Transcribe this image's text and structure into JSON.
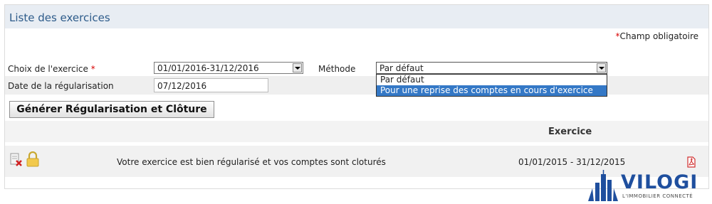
{
  "panel": {
    "title": "Liste des exercices"
  },
  "required_note": {
    "star": "*",
    "text": "Champ obligatoire"
  },
  "form": {
    "exercise_label": "Choix de l'exercice",
    "exercise_required": "*",
    "exercise_value": "01/01/2016-31/12/2016",
    "method_label": "Méthode",
    "method_value": "Par défaut",
    "method_options": [
      "Par défaut",
      "Pour une reprise des comptes en cours d'exercice"
    ],
    "method_highlighted_index": 1,
    "date_label": "Date de la régularisation",
    "date_value": "07/12/2016",
    "generate_button": "Générer Régularisation et Clôture"
  },
  "table": {
    "column_header": "Exercice",
    "rows": [
      {
        "message": "Votre exercice est bien régularisé et vos comptes sont cloturés",
        "period": "01/01/2015 - 31/12/2015"
      }
    ]
  },
  "logo": {
    "name": "VILOGI",
    "tagline": "L'IMMOBILIER CONNECTÉ"
  },
  "colors": {
    "title_blue": "#2d5b8a",
    "required_red": "#d80000",
    "highlight_blue": "#3478c6",
    "logo_blue": "#1f4f9e"
  }
}
